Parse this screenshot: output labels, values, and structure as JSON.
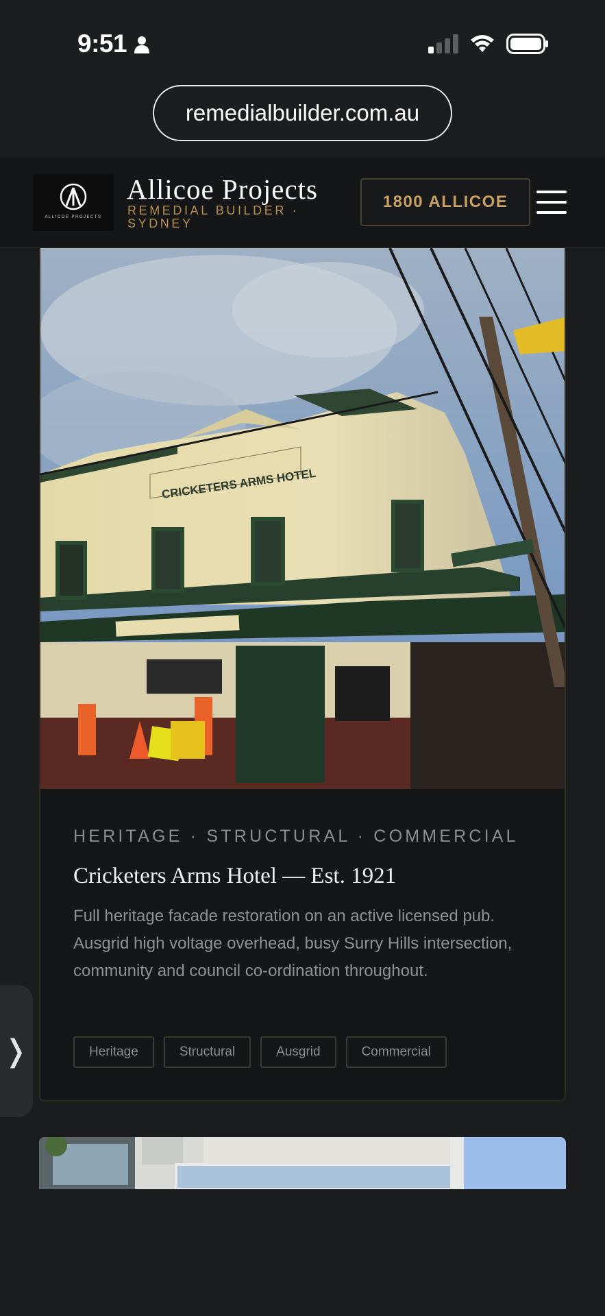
{
  "status_bar": {
    "time": "9:51",
    "icons": [
      "person-icon",
      "cellular-signal-icon",
      "wifi-icon",
      "battery-icon"
    ]
  },
  "browser": {
    "url": "remedialbuilder.com.au"
  },
  "header": {
    "logo_text": "ALLICOE PROJECTS",
    "brand_name": "Allicoe Projects",
    "tagline": "REMEDIAL BUILDER · SYDNEY",
    "phone_label": "1800 ALLICOE",
    "menu_icon": "hamburger-menu-icon",
    "accent_color": "#c9a060"
  },
  "project": {
    "photo_sign_text": "CRICKETERS ARMS HOTEL",
    "categories": "HERITAGE · STRUCTURAL · COMMERCIAL",
    "title": "Cricketers Arms Hotel — Est. 1921",
    "description": "Full heritage facade restoration on an active licensed pub. Ausgrid high voltage overhead, busy Surry Hills intersection, community and council co-ordination throughout.",
    "tags": [
      "Heritage",
      "Structural",
      "Ausgrid",
      "Commercial"
    ]
  },
  "side_tab": {
    "glyph": "❭"
  }
}
